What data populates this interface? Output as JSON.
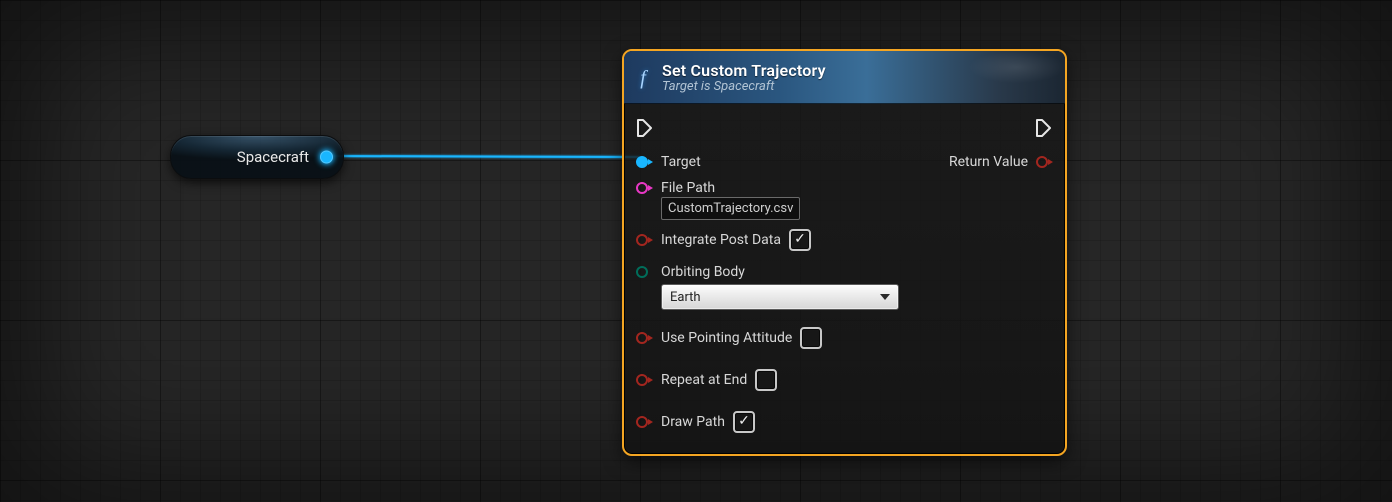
{
  "source_node": {
    "label": "Spacecraft",
    "output_pin_type": "object"
  },
  "function_node": {
    "icon_glyph": "f",
    "title": "Set Custom Trajectory",
    "subtitle": "Target is Spacecraft",
    "inputs": {
      "target": {
        "label": "Target",
        "connected": true,
        "pin_color": "blue"
      },
      "file_path": {
        "label": "File Path",
        "value": "CustomTrajectory.csv",
        "pin_color": "pink"
      },
      "integrate_post_data": {
        "label": "Integrate Post Data",
        "checked": true,
        "pin_color": "red"
      },
      "orbiting_body": {
        "label": "Orbiting Body",
        "value": "Earth",
        "pin_color": "teal"
      },
      "use_pointing_attitude": {
        "label": "Use Pointing Attitude",
        "checked": false,
        "pin_color": "red"
      },
      "repeat_at_end": {
        "label": "Repeat at End",
        "checked": false,
        "pin_color": "red"
      },
      "draw_path": {
        "label": "Draw Path",
        "checked": true,
        "pin_color": "red"
      }
    },
    "outputs": {
      "return_value": {
        "label": "Return Value",
        "pin_color": "red"
      }
    }
  }
}
